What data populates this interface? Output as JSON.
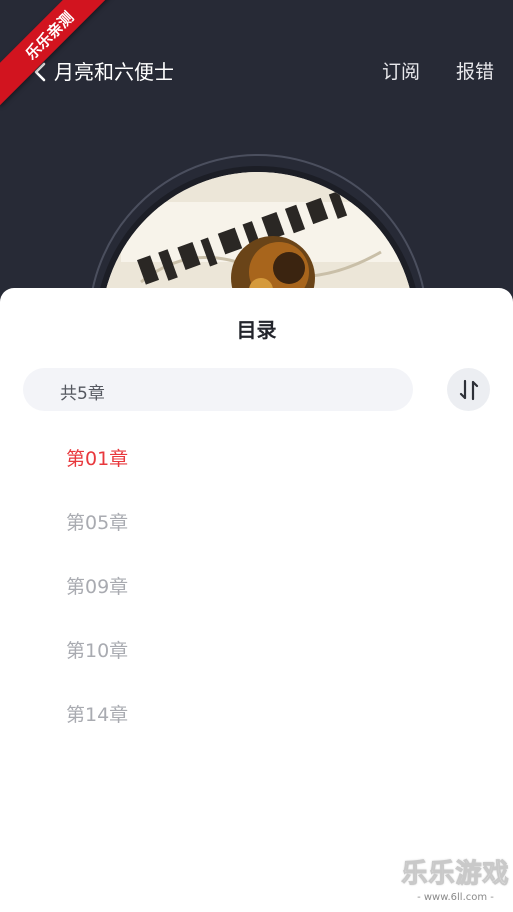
{
  "badge": "乐乐亲测",
  "header": {
    "title": "月亮和六便士",
    "subscribe_label": "订阅",
    "report_label": "报错"
  },
  "catalog": {
    "title": "目录",
    "count_text": "共5章",
    "chapters": [
      {
        "label": "第01章",
        "active": true
      },
      {
        "label": "第05章",
        "active": false
      },
      {
        "label": "第09章",
        "active": false
      },
      {
        "label": "第10章",
        "active": false
      },
      {
        "label": "第14章",
        "active": false
      }
    ]
  },
  "watermark": {
    "name": "乐乐游戏",
    "url": "- www.6ll.com -"
  },
  "colors": {
    "header_bg": "#272a36",
    "active_chapter": "#e8383d",
    "inactive_chapter": "#a9abb1",
    "badge_red": "#d2141f"
  }
}
